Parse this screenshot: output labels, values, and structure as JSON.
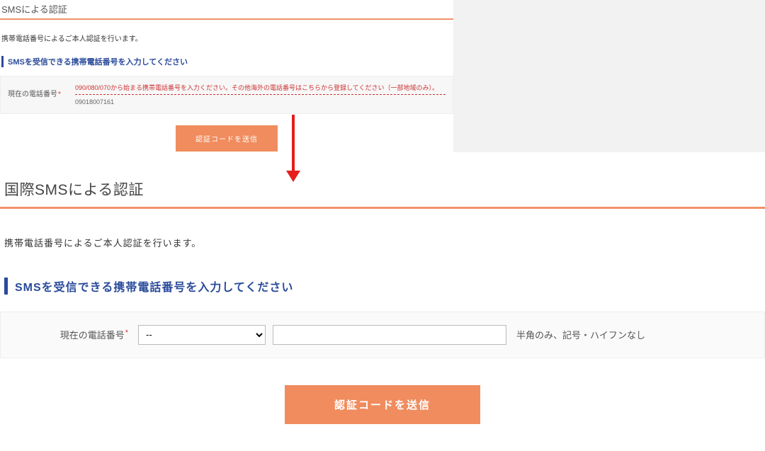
{
  "top": {
    "title": "SMSによる認証",
    "desc": "携帯電話番号によるご本人認証を行います。",
    "subhead": "SMSを受信できる携帯電話番号を入力してください",
    "label": "現在の電話番号",
    "help_text": "090/080/070から始まる携帯電話番号を入力ください。その他海外の電話番号はこちらから登録してください（一部地域のみ）。",
    "value": "09018007161",
    "button": "認証コードを送信"
  },
  "bottom": {
    "title": "国際SMSによる認証",
    "desc": "携帯電話番号によるご本人認証を行います。",
    "subhead": "SMSを受信できる携帯電話番号を入力してください",
    "label": "現在の電話番号",
    "select_value": "--",
    "input_value": "",
    "hint": "半角のみ、記号・ハイフンなし",
    "button": "認証コードを送信"
  }
}
